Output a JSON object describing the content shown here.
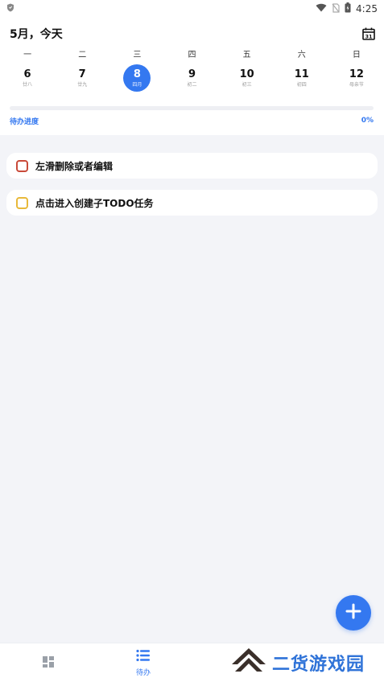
{
  "status_bar": {
    "time": "4:25",
    "icons": [
      "shield-icon",
      "wifi-icon",
      "no-sim-icon",
      "battery-icon"
    ]
  },
  "header": {
    "month_title": "5月，今天",
    "calendar_icon": "calendar-icon"
  },
  "week": {
    "days": [
      {
        "weekday": "一",
        "date": "6",
        "lunar": "廿八",
        "selected": false
      },
      {
        "weekday": "二",
        "date": "7",
        "lunar": "廿九",
        "selected": false
      },
      {
        "weekday": "三",
        "date": "8",
        "lunar": "四月",
        "selected": true
      },
      {
        "weekday": "四",
        "date": "9",
        "lunar": "初二",
        "selected": false
      },
      {
        "weekday": "五",
        "date": "10",
        "lunar": "初三",
        "selected": false
      },
      {
        "weekday": "六",
        "date": "11",
        "lunar": "初四",
        "selected": false
      },
      {
        "weekday": "日",
        "date": "12",
        "lunar": "母亲节",
        "selected": false
      }
    ]
  },
  "progress": {
    "label": "待办进度",
    "percent_text": "0%",
    "fraction": 0
  },
  "tasks": [
    {
      "text": "左滑删除或者编辑",
      "checkbox_color": "#c94a3a"
    },
    {
      "text": "点击进入创建子TODO任务",
      "checkbox_color": "#e8b93a"
    }
  ],
  "fab": {
    "icon": "plus-icon"
  },
  "bottom_nav": {
    "items": [
      {
        "icon": "dashboard-icon",
        "label": ""
      },
      {
        "icon": "list-icon",
        "label": "待办"
      }
    ]
  },
  "watermark": {
    "text": "二货游戏园"
  },
  "colors": {
    "accent": "#3478f0",
    "background": "#f3f4f8",
    "card": "#ffffff"
  }
}
